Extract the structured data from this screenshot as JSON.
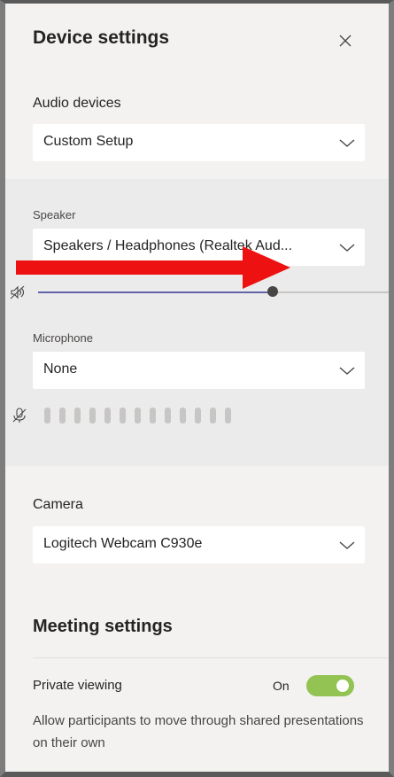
{
  "panel": {
    "title": "Device settings"
  },
  "audio": {
    "section_label": "Audio devices",
    "selected": "Custom Setup"
  },
  "speaker": {
    "label": "Speaker",
    "selected": "Speakers / Headphones (Realtek Aud...",
    "volume_fraction": 0.67
  },
  "microphone": {
    "label": "Microphone",
    "selected": "None",
    "meter_bars": 13
  },
  "camera": {
    "label": "Camera",
    "selected": "Logitech Webcam C930e"
  },
  "meeting": {
    "title": "Meeting settings",
    "private_viewing_label": "Private viewing",
    "toggle_state": "On",
    "toggle_on": true,
    "description": "Allow participants to move through shared presentations on their own"
  },
  "colors": {
    "accent": "#6264a7",
    "toggle_on": "#92c353",
    "annotation_arrow": "#ee1111"
  },
  "icons": {
    "close": "close-icon",
    "chevron": "chevron-down-icon",
    "speaker_mute": "speaker-mute-icon",
    "mic_mute": "microphone-mute-icon"
  }
}
